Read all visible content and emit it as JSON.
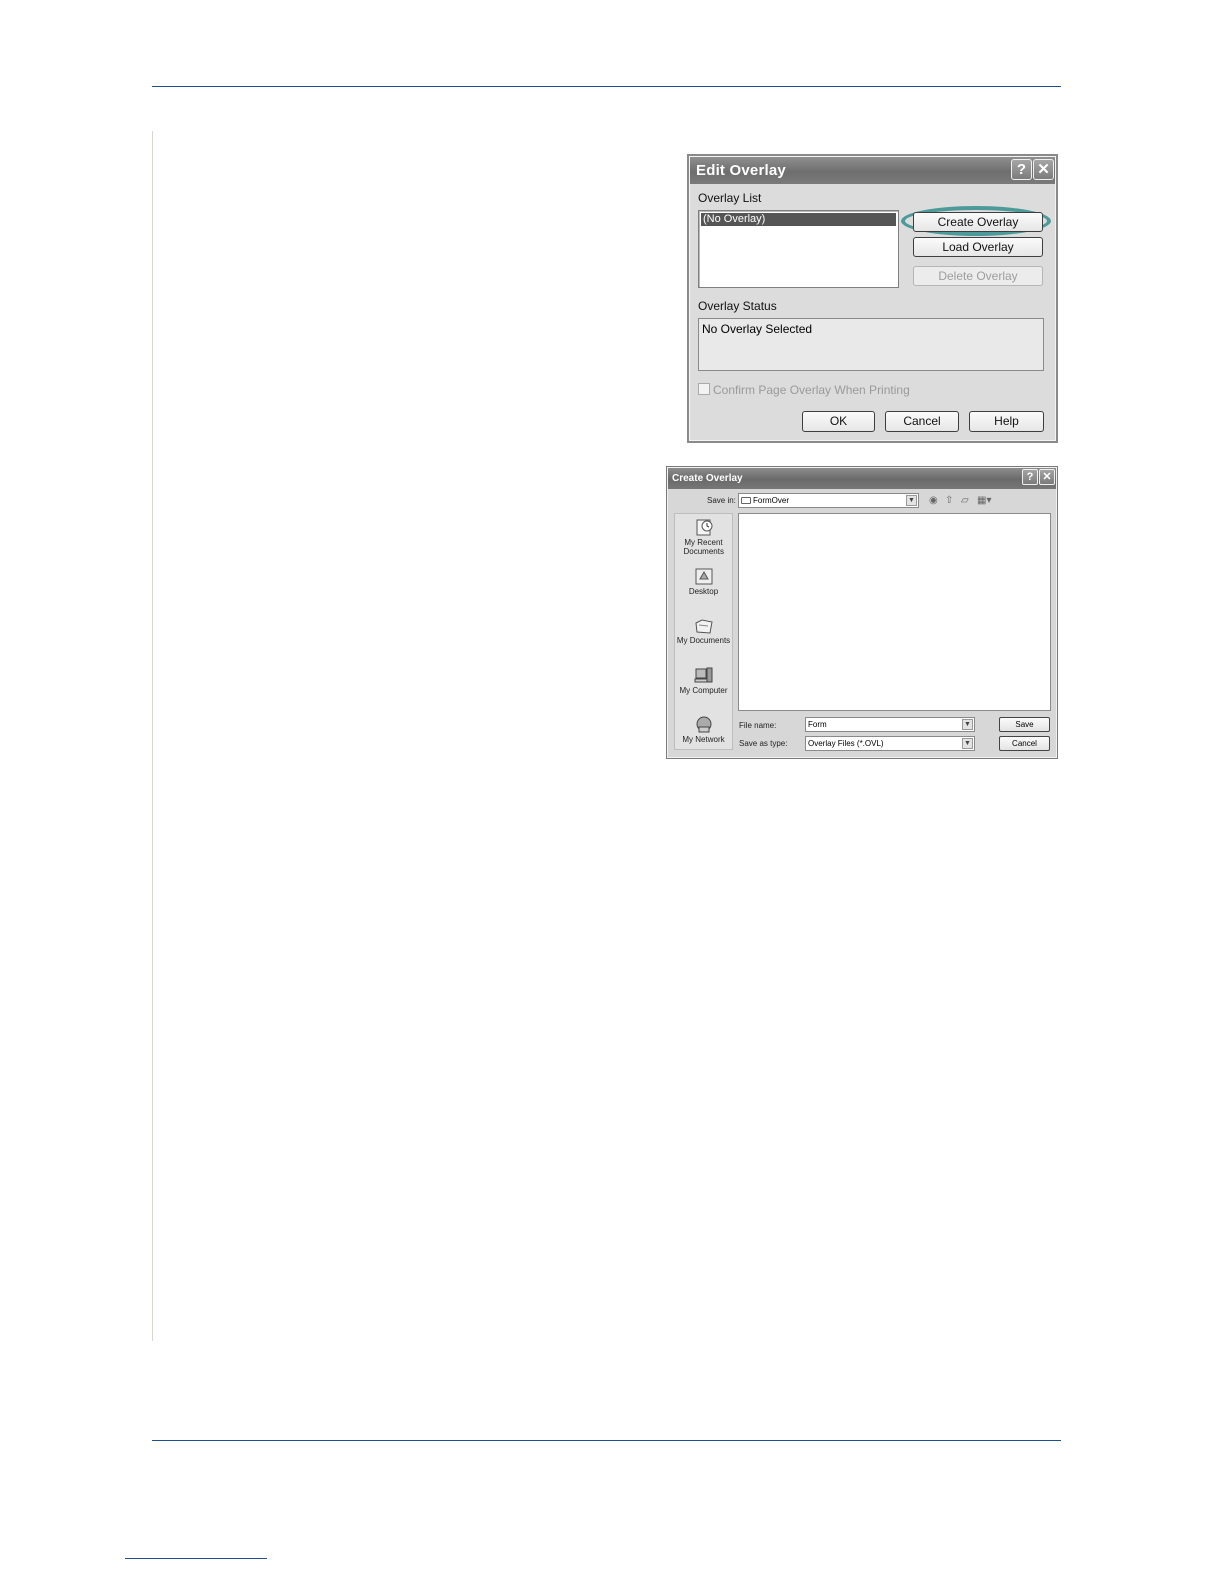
{
  "edit_overlay": {
    "title": "Edit Overlay",
    "help_glyph": "?",
    "close_glyph": "✕",
    "overlay_list_label": "Overlay List",
    "overlay_list_items": [
      "(No Overlay)"
    ],
    "create_button": "Create Overlay",
    "load_button": "Load Overlay",
    "delete_button": "Delete Overlay",
    "overlay_status_label": "Overlay Status",
    "overlay_status_text": "No Overlay Selected",
    "confirm_checkbox_label": "Confirm Page Overlay When Printing",
    "ok_button": "OK",
    "cancel_button": "Cancel",
    "help_button": "Help",
    "highlight_color": "#4d9a9a"
  },
  "create_overlay": {
    "title": "Create Overlay",
    "help_glyph": "?",
    "close_glyph": "✕",
    "save_in_label": "Save in:",
    "save_in_value": "FormOver",
    "places": [
      "My Recent Documents",
      "Desktop",
      "My Documents",
      "My Computer",
      "My Network"
    ],
    "file_name_label": "File name:",
    "file_name_value": "Form",
    "save_as_type_label": "Save as type:",
    "save_as_type_value": "Overlay Files (*.OVL)",
    "save_button": "Save",
    "cancel_button": "Cancel"
  }
}
